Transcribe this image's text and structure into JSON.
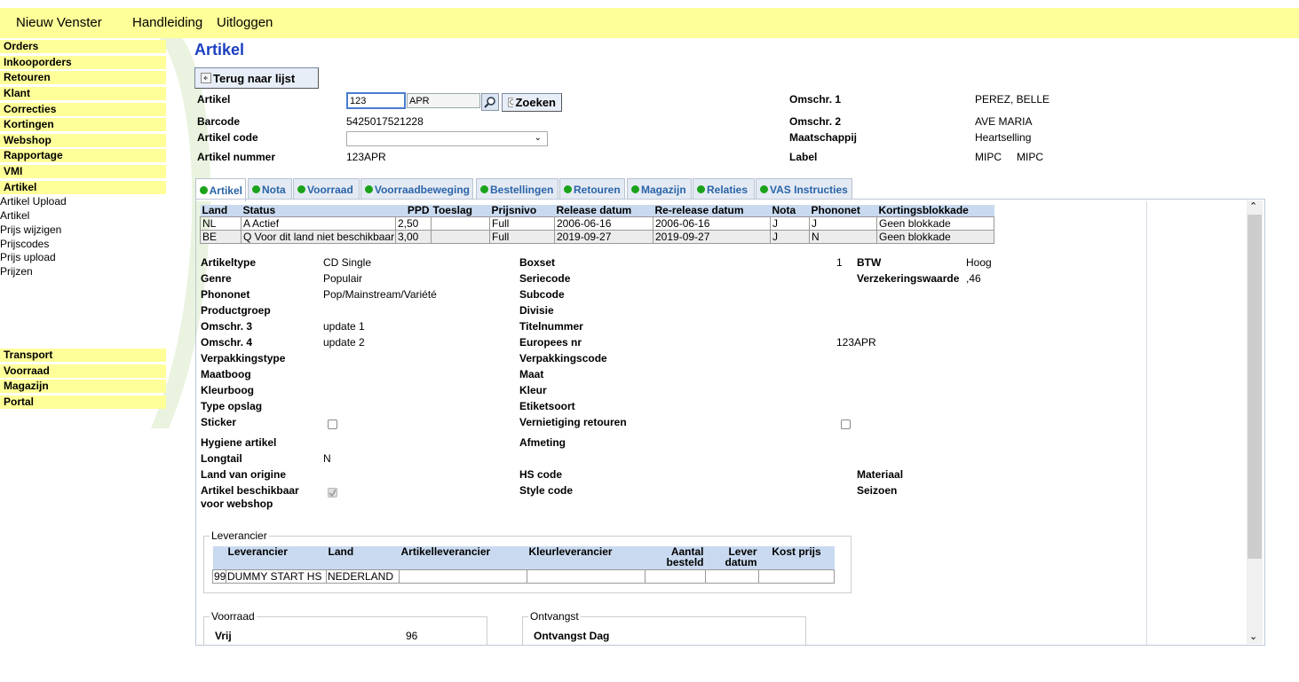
{
  "topnav": {
    "new_window": "Nieuw Venster",
    "manual": "Handleiding",
    "logout": "Uitloggen"
  },
  "sidebar": {
    "items": [
      "Orders",
      "Inkooporders",
      "Retouren",
      "Klant",
      "Correcties",
      "Kortingen",
      "Webshop",
      "Rapportage",
      "VMI",
      "Artikel"
    ],
    "subitems": [
      "Artikel Upload",
      "Artikel",
      "Prijs wijzigen",
      "Prijscodes",
      "Prijs upload",
      "Prijzen"
    ],
    "bottom_items": [
      "Transport",
      "Voorraad",
      "Magazijn",
      "Portal"
    ]
  },
  "page": {
    "title": "Artikel",
    "back_button": "Terug naar lijst"
  },
  "header": {
    "artikel_label": "Artikel",
    "artikel_value": "123",
    "artikel_suffix": "APR",
    "search_button": "Zoeken",
    "barcode_label": "Barcode",
    "barcode_value": "5425017521228",
    "code_label": "Artikel code",
    "code_value": "",
    "nummer_label": "Artikel nummer",
    "nummer_value": "123APR",
    "omschr1_label": "Omschr. 1",
    "omschr1_value": "PEREZ, BELLE",
    "omschr2_label": "Omschr. 2",
    "omschr2_value": "AVE MARIA",
    "maatschappij_label": "Maatschappij",
    "maatschappij_value": "Heartselling",
    "label_label": "Label",
    "label_value1": "MIPC",
    "label_value2": "MIPC"
  },
  "tabs": [
    "Artikel",
    "Nota",
    "Voorraad",
    "Voorraadbeweging",
    "Bestellingen",
    "Retouren",
    "Magazijn",
    "Relaties",
    "VAS Instructies"
  ],
  "status_colors": {
    "tab_dot": "#1aa31a",
    "title": "#1a3fc2",
    "menu_bg": "#ffff99"
  },
  "country_table": {
    "headers": [
      "Land",
      "Status",
      "PPD",
      "Toeslag",
      "Prijsnivo",
      "Release datum",
      "Re-release datum",
      "Nota",
      "Phononet",
      "Kortingsblokkade"
    ],
    "rows": [
      [
        "NL",
        "A Actief",
        "2,50",
        "",
        "Full",
        "2006-06-16",
        "2006-06-16",
        "J",
        "J",
        "Geen blokkade"
      ],
      [
        "BE",
        "Q Voor dit land niet beschikbaar",
        "3,00",
        "",
        "Full",
        "2019-09-27",
        "2019-09-27",
        "J",
        "N",
        "Geen blokkade"
      ]
    ]
  },
  "fields": {
    "artikeltype_l": "Artikeltype",
    "artikeltype_v": "CD Single",
    "genre_l": "Genre",
    "genre_v": "Populair",
    "phononet_l": "Phononet",
    "phononet_v": "Pop/Mainstream/Variété",
    "productgroep_l": "Productgroep",
    "omschr3_l": "Omschr. 3",
    "omschr3_v": "update 1",
    "omschr4_l": "Omschr. 4",
    "omschr4_v": "update 2",
    "verpakkingstype_l": "Verpakkingstype",
    "maatboog_l": "Maatboog",
    "kleurboog_l": "Kleurboog",
    "typeopslag_l": "Type opslag",
    "sticker_l": "Sticker",
    "hygiene_l": "Hygiene artikel",
    "longtail_l": "Longtail",
    "longtail_v": "N",
    "landorigine_l": "Land van origine",
    "webshop_l1": "Artikel beschikbaar",
    "webshop_l2": "voor webshop",
    "boxset_l": "Boxset",
    "boxset_v": "1",
    "seriecode_l": "Seriecode",
    "subcode_l": "Subcode",
    "divisie_l": "Divisie",
    "titelnummer_l": "Titelnummer",
    "europees_l": "Europees nr",
    "europees_v": "123APR",
    "verpakkingscode_l": "Verpakkingscode",
    "maat_l": "Maat",
    "kleur_l": "Kleur",
    "etiketsoort_l": "Etiketsoort",
    "vernietiging_l": "Vernietiging retouren",
    "afmeting_l": "Afmeting",
    "hscode_l": "HS code",
    "stylecode_l": "Style code",
    "btw_l": "BTW",
    "btw_v": "Hoog",
    "verzekering_l": "Verzekeringswaarde",
    "verzekering_v": ",46",
    "materiaal_l": "Materiaal",
    "seizoen_l": "Seizoen"
  },
  "leverancier": {
    "legend": "Leverancier",
    "headers": [
      "Leverancier",
      "Land",
      "Artikelleverancier",
      "Kleurleverancier",
      "Aantal besteld",
      "Lever datum",
      "Kost prijs"
    ],
    "rows": [
      [
        "99",
        "DUMMY START HS",
        "NEDERLAND",
        "",
        "",
        "",
        "",
        ""
      ]
    ]
  },
  "voorraad": {
    "legend": "Voorraad",
    "vrij_l": "Vrij",
    "vrij_v": "96"
  },
  "ontvangst": {
    "legend": "Ontvangst",
    "dag_l": "Ontvangst Dag"
  }
}
